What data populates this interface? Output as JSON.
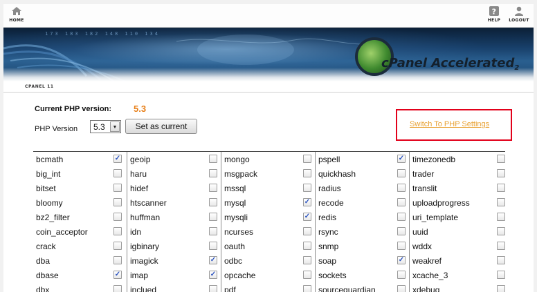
{
  "nav": {
    "home_label": "HOME",
    "help_label": "HELP",
    "logout_label": "LOGOUT"
  },
  "banner": {
    "logo_main": "cPanel Accelerated",
    "logo_sub": "2",
    "numbers": "173   183   182   148   110   134"
  },
  "tabstrip": {
    "label": "CPANEL 11"
  },
  "php": {
    "current_label": "Current PHP version:",
    "current_value": "5.3",
    "version_label": "PHP Version",
    "selected_version": "5.3",
    "set_button_label": "Set as current",
    "switch_link_label": "Switch To PHP Settings"
  },
  "colors": {
    "accent_orange": "#e8801a",
    "highlight_red": "#e2001a",
    "check_blue": "#2a52be"
  },
  "modules": [
    [
      {
        "name": "bcmath",
        "checked": true
      },
      {
        "name": "big_int",
        "checked": false
      },
      {
        "name": "bitset",
        "checked": false
      },
      {
        "name": "bloomy",
        "checked": false
      },
      {
        "name": "bz2_filter",
        "checked": false
      },
      {
        "name": "coin_acceptor",
        "checked": false
      },
      {
        "name": "crack",
        "checked": false
      },
      {
        "name": "dba",
        "checked": false
      },
      {
        "name": "dbase",
        "checked": true
      },
      {
        "name": "dbx",
        "checked": false
      }
    ],
    [
      {
        "name": "geoip",
        "checked": false
      },
      {
        "name": "haru",
        "checked": false
      },
      {
        "name": "hidef",
        "checked": false
      },
      {
        "name": "htscanner",
        "checked": false
      },
      {
        "name": "huffman",
        "checked": false
      },
      {
        "name": "idn",
        "checked": false
      },
      {
        "name": "igbinary",
        "checked": false
      },
      {
        "name": "imagick",
        "checked": true
      },
      {
        "name": "imap",
        "checked": true
      },
      {
        "name": "inclued",
        "checked": false
      }
    ],
    [
      {
        "name": "mongo",
        "checked": false
      },
      {
        "name": "msgpack",
        "checked": false
      },
      {
        "name": "mssql",
        "checked": false
      },
      {
        "name": "mysql",
        "checked": true
      },
      {
        "name": "mysqli",
        "checked": true
      },
      {
        "name": "ncurses",
        "checked": false
      },
      {
        "name": "oauth",
        "checked": false
      },
      {
        "name": "odbc",
        "checked": false
      },
      {
        "name": "opcache",
        "checked": false
      },
      {
        "name": "pdf",
        "checked": false
      }
    ],
    [
      {
        "name": "pspell",
        "checked": true
      },
      {
        "name": "quickhash",
        "checked": false
      },
      {
        "name": "radius",
        "checked": false
      },
      {
        "name": "recode",
        "checked": false
      },
      {
        "name": "redis",
        "checked": false
      },
      {
        "name": "rsync",
        "checked": false
      },
      {
        "name": "snmp",
        "checked": false
      },
      {
        "name": "soap",
        "checked": true
      },
      {
        "name": "sockets",
        "checked": false
      },
      {
        "name": "sourceguardian",
        "checked": false
      }
    ],
    [
      {
        "name": "timezonedb",
        "checked": false
      },
      {
        "name": "trader",
        "checked": false
      },
      {
        "name": "translit",
        "checked": false
      },
      {
        "name": "uploadprogress",
        "checked": false
      },
      {
        "name": "uri_template",
        "checked": false
      },
      {
        "name": "uuid",
        "checked": false
      },
      {
        "name": "wddx",
        "checked": false
      },
      {
        "name": "weakref",
        "checked": false
      },
      {
        "name": "xcache_3",
        "checked": false
      },
      {
        "name": "xdebug",
        "checked": false
      }
    ]
  ]
}
